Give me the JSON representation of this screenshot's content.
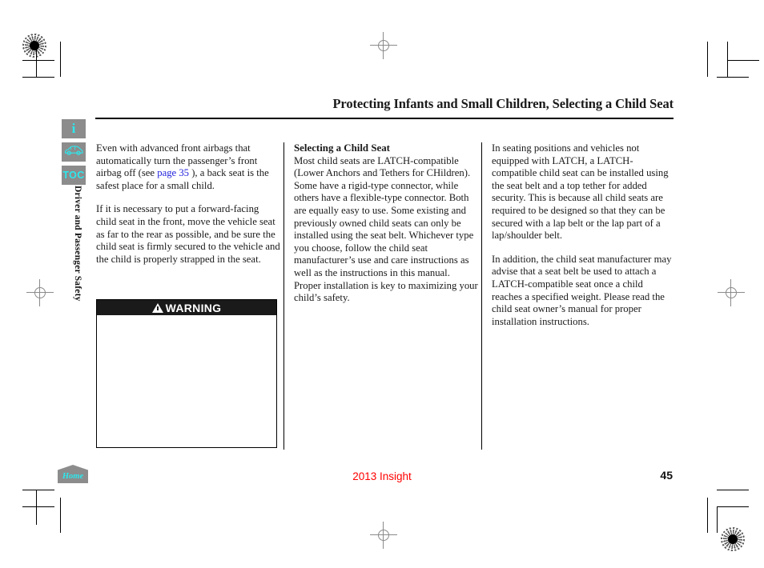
{
  "document": {
    "title": "Protecting Infants and Small Children, Selecting a Child Seat",
    "side_tab_label": "Driver and Passenger Safety"
  },
  "sidebar": {
    "items": [
      {
        "name": "info-button",
        "label": "i",
        "icon": "info-icon"
      },
      {
        "name": "vehicle-button",
        "label": "",
        "icon": "car-icon"
      },
      {
        "name": "toc-button",
        "label": "TOC",
        "icon": "toc-icon"
      }
    ]
  },
  "columns": {
    "one": {
      "paragraph_1_before_link": "Even with advanced front airbags that automatically turn the passenger’s front airbag off (see ",
      "link_text": "page 35",
      "paragraph_1_after_link": " ), a back seat is the safest place for a small child.",
      "paragraph_2": "If it is necessary to put a forward-facing child seat in the front, move the vehicle seat as far to the rear as possible, and be sure the child seat is firmly secured to the vehicle and the child is properly strapped in the seat."
    },
    "two": {
      "heading": "Selecting a Child Seat",
      "paragraph_1": "Most child seats are LATCH-compatible (Lower Anchors and Tethers for CHildren). Some have a rigid-type connector, while others have a flexible-type connector. Both are equally easy to use. Some existing and previously owned child seats can only be installed using the seat belt. Whichever type you choose, follow the child seat manufacturer’s use and care instructions as well as the instructions in this manual. Proper installation is key to maximizing your child’s safety."
    },
    "three": {
      "paragraph_1": "In seating positions and vehicles not equipped with LATCH, a LATCH-compatible child seat can be installed using the seat belt and a top tether for added security. This is because all child seats are required to be designed so that they can be secured with a lap belt or the lap part of a lap/shoulder belt.",
      "paragraph_2": "In addition, the child seat manufacturer may advise that a seat belt be used to attach a LATCH-compatible seat once a child reaches a specified weight. Please read the child seat owner’s manual for proper installation instructions."
    }
  },
  "warning": {
    "label": "WARNING",
    "icon": "warning-triangle-icon",
    "body": ""
  },
  "footer": {
    "home_label": "Home",
    "model": "2013 Insight",
    "page_number": "45"
  },
  "colors": {
    "link": "#2222dd",
    "accent_cyan": "#2ce8ee",
    "button_gray": "#8c8c8c",
    "footer_red": "#ff0000",
    "warning_bar": "#1a1a1a"
  }
}
